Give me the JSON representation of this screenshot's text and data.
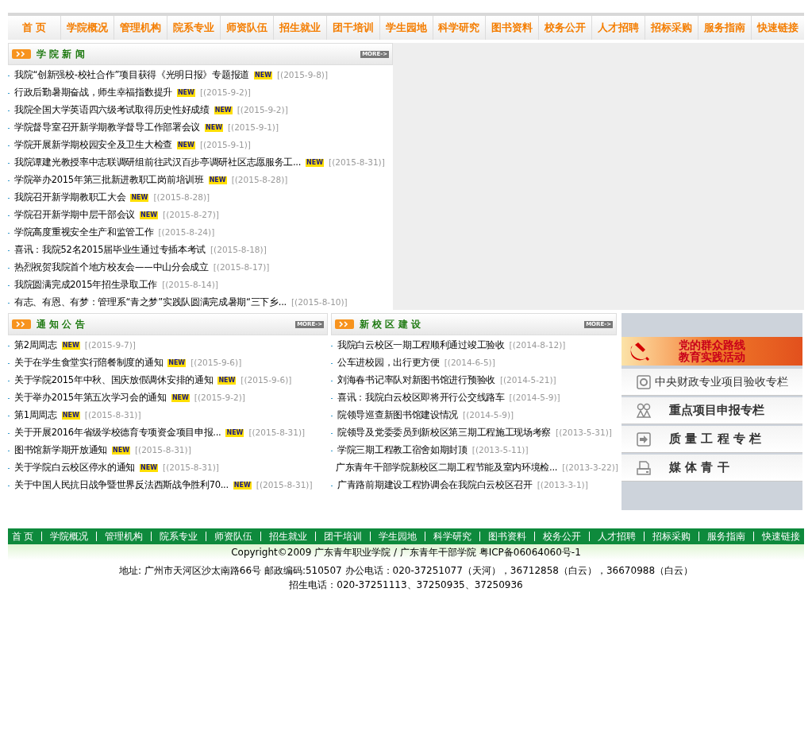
{
  "nav": [
    "首 页",
    "学院概况",
    "管理机构",
    "院系专业",
    "师资队伍",
    "招生就业",
    "团干培训",
    "学生园地",
    "科学研究",
    "图书资料",
    "校务公开",
    "人才招聘",
    "招标采购",
    "服务指南",
    "快速链接"
  ],
  "sections": [
    {
      "title": "学 院 新 闻",
      "more": "MORE->",
      "items": [
        {
          "text": "我院“创新强校-校社合作”项目获得《光明日报》专题报道",
          "badge": "NEW",
          "date": "[(2015-9-8)]"
        },
        {
          "text": "行政后勤暑期奋战，师生幸福指数提升",
          "badge": "NEW",
          "date": "[(2015-9-2)]"
        },
        {
          "text": "我院全国大学英语四六级考试取得历史性好成绩",
          "badge": "NEW",
          "date": "[(2015-9-2)]"
        },
        {
          "text": "学院督导室召开新学期教学督导工作部署会议",
          "badge": "NEW",
          "date": "[(2015-9-1)]"
        },
        {
          "text": "学院开展新学期校园安全及卫生大检查",
          "badge": "NEW",
          "date": "[(2015-9-1)]"
        },
        {
          "text": "我院谭建光教授率中志联调研组前往武汉百步亭调研社区志愿服务工...",
          "badge": "NEW",
          "date": "[(2015-8-31)]"
        },
        {
          "text": "学院举办2015年第三批新进教职工岗前培训班",
          "badge": "NEW",
          "date": "[(2015-8-28)]"
        },
        {
          "text": "我院召开新学期教职工大会",
          "badge": "NEW",
          "date": "[(2015-8-28)]"
        },
        {
          "text": "学院召开新学期中层干部会议",
          "badge": "NEW",
          "date": "[(2015-8-27)]"
        },
        {
          "text": "学院高度重视安全生产和监管工作",
          "date": "[(2015-8-24)]"
        },
        {
          "text": "喜讯：我院52名2015届毕业生通过专插本考试",
          "date": "[(2015-8-18)]"
        },
        {
          "text": "热烈祝贺我院首个地方校友会——中山分会成立",
          "date": "[(2015-8-17)]"
        },
        {
          "text": "我院圆满完成2015年招生录取工作",
          "date": "[(2015-8-14)]"
        },
        {
          "text": "有志、有恩、有梦：管理系“青之梦”实践队圆满完成暑期“三下乡...",
          "date": "[(2015-8-10)]"
        }
      ]
    },
    {
      "title": "通 知 公 告",
      "more": "MORE->",
      "items": [
        {
          "text": "第2周周志",
          "badge": "NEW",
          "date": "[(2015-9-7)]"
        },
        {
          "text": "关于在学生食堂实行陪餐制度的通知",
          "badge": "NEW",
          "date": "[(2015-9-6)]"
        },
        {
          "text": "关于学院2015年中秋、国庆放假调休安排的通知",
          "badge": "NEW",
          "date": "[(2015-9-6)]"
        },
        {
          "text": "关于举办2015年第五次学习会的通知",
          "badge": "NEW",
          "date": "[(2015-9-2)]"
        },
        {
          "text": "第1周周志",
          "badge": "NEW",
          "date": "[(2015-8-31)]"
        },
        {
          "text": "关于开展2016年省级学校德育专项资金项目申报...",
          "badge": "NEW",
          "date": "[(2015-8-31)]"
        },
        {
          "text": "图书馆新学期开放通知",
          "badge": "NEW",
          "date": "[(2015-8-31)]"
        },
        {
          "text": "关于学院白云校区停水的通知",
          "badge": "NEW",
          "date": "[(2015-8-31)]"
        },
        {
          "text": "关于中国人民抗日战争暨世界反法西斯战争胜利70...",
          "badge": "NEW",
          "date": "[(2015-8-31)]"
        }
      ]
    },
    {
      "title": "新 校 区 建 设",
      "more": "MORE->",
      "items": [
        {
          "text": "我院白云校区一期工程顺利通过竣工验收",
          "date": "[(2014-8-12)]"
        },
        {
          "text": "公车进校园，出行更方便",
          "date": "[(2014-6-5)]"
        },
        {
          "text": "刘海春书记率队对新图书馆进行预验收",
          "date": "[(2014-5-21)]"
        },
        {
          "text": "喜讯：我院白云校区即将开行公交线路车",
          "date": "[(2014-5-9)]"
        },
        {
          "text": "院领导巡查新图书馆建设情况",
          "date": "[(2014-5-9)]"
        },
        {
          "text": "院领导及党委委员到新校区第三期工程施工现场考察",
          "date": "[(2013-5-31)]"
        },
        {
          "text": "学院三期工程教工宿舍如期封顶",
          "date": "[(2013-5-11)]"
        },
        {
          "text": "广东青年干部学院新校区二期工程节能及室内环境检...",
          "date": "[(2013-3-22)]"
        },
        {
          "text": "广青路前期建设工程协调会在我院白云校区召开",
          "date": "[(2013-3-1)]"
        }
      ]
    }
  ],
  "banner": {
    "line_1": "党的群众路线",
    "line_2": "教育实践活动"
  },
  "side_links": [
    {
      "kind": "target",
      "label": "中央财政专业项目验收专栏"
    },
    {
      "kind": "people",
      "label": "重点项目申报专栏"
    },
    {
      "kind": "arrow",
      "label": "质 量 工 程 专 栏"
    },
    {
      "kind": "printer",
      "label": "媒 体 青 干"
    }
  ],
  "footer": {
    "nav": [
      "首 页",
      "学院概况",
      "管理机构",
      "院系专业",
      "师资队伍",
      "招生就业",
      "团干培训",
      "学生园地",
      "科学研究",
      "图书资料",
      "校务公开",
      "人才招聘",
      "招标采购",
      "服务指南",
      "快速链接"
    ],
    "copyright": "Copyright©2009 广东青年职业学院 / 广东青年干部学院 粤ICP备06064060号-1",
    "address": "地址: 广州市天河区沙太南路66号 邮政编码:510507 办公电话：020-37251077（天河），36712858（白云），36670988（白云）",
    "admissions": "招生电话：020-37251113、37250935、37250936"
  }
}
